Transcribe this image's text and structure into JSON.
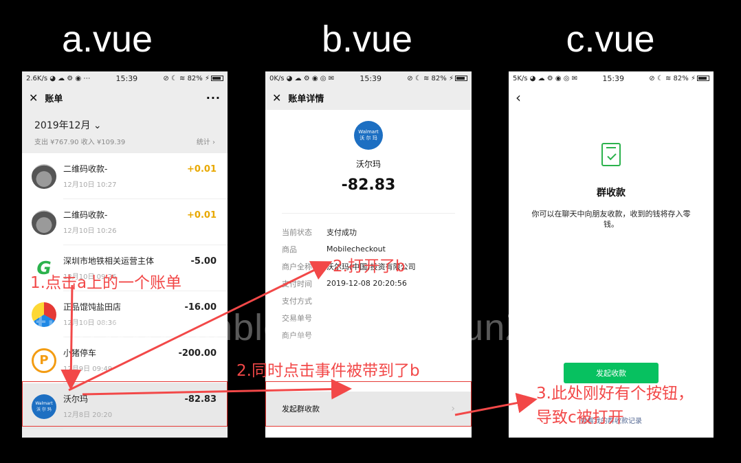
{
  "headings": {
    "a": "a.vue",
    "b": "b.vue",
    "c": "c.vue"
  },
  "phone_a": {
    "status": {
      "left": "2.6K/s ◕ ☁ ⚙ ◉ ⋯",
      "time": "15:39",
      "right": "⊘ ☾ ≋ 82% ⚡"
    },
    "nav": {
      "close": "✕",
      "title": "账单",
      "more": "···"
    },
    "month": "2019年12月 ⌄",
    "summary": "支出 ¥767.90 收入 ¥109.39",
    "stats": "统计 ›",
    "rows": [
      {
        "name": "二维码收款-",
        "date": "12月10日 10:27",
        "amount": "+0.01"
      },
      {
        "name": "二维码收款-",
        "date": "12月10日 10:26",
        "amount": "+0.01"
      },
      {
        "name": "深圳市地铁相关运营主体",
        "date": "12月10日 09:26",
        "amount": "-5.00"
      },
      {
        "name": "正品馄饨盐田店",
        "date": "12月10日 08:36",
        "amount": "-16.00"
      },
      {
        "name": "小猪停车",
        "date": "12月9日 09:49",
        "amount": "-200.00"
      },
      {
        "name": "沃尔玛",
        "date": "12月8日 20:20",
        "amount": "-82.83"
      }
    ],
    "walmart_logo": {
      "en": "Walmart",
      "cn": "沃 尔 玛"
    }
  },
  "phone_b": {
    "status": {
      "left": "0K/s ◕ ☁ ⚙ ◉ ◎ ✉",
      "time": "15:39",
      "right": "⊘ ☾ ≋ 82% ⚡"
    },
    "nav": {
      "close": "✕",
      "title": "账单详情"
    },
    "merchant_logo": {
      "en": "Walmart",
      "cn": "沃 尔 玛"
    },
    "merchant": "沃尔玛",
    "amount": "-82.83",
    "fields": [
      {
        "k": "当前状态",
        "v": "支付成功"
      },
      {
        "k": "商品",
        "v": "Mobilecheckout"
      },
      {
        "k": "商户全称",
        "v": "沃尔玛(中国)投资有限公司"
      },
      {
        "k": "支付时间",
        "v": "2019-12-08 20:20:56"
      },
      {
        "k": "支付方式",
        "v": ""
      },
      {
        "k": "交易单号",
        "v": ""
      },
      {
        "k": "商户单号",
        "v": ""
      }
    ],
    "group_label": "发起群收款",
    "group_chevron": "›"
  },
  "phone_c": {
    "status": {
      "left": "5K/s ◕ ☁ ⚙ ◉ ◎ ✉",
      "time": "15:39",
      "right": "⊘ ☾ ≋ 82% ⚡"
    },
    "back": "‹",
    "title": "群收款",
    "desc": "你可以在聊天中向朋友收款，收到的钱将存入零钱。",
    "button": "发起收款",
    "record": "查看我的群收款记录"
  },
  "annotations": {
    "step1": "1.点击a上的一个账单",
    "step2a": "2.打开了b",
    "step2b": "2.同时点击事件被带到了b",
    "step3_line1": "3.此处刚好有个按钮，",
    "step3_line2": "导致c被打开"
  },
  "watermark": "ttp://www.cnblogs.com/YeunZhang/",
  "colors": {
    "annotation": "#f24848",
    "accent_green": "#07c160",
    "income": "#e8a800"
  }
}
